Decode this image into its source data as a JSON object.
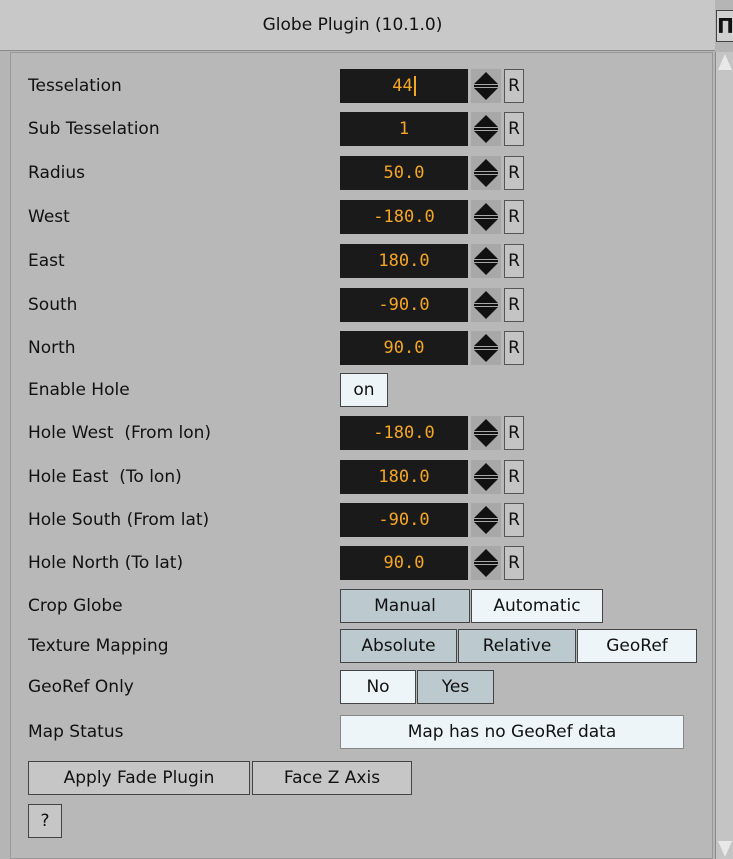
{
  "window": {
    "title": "Globe Plugin (10.1.0)",
    "title_icon": "Π"
  },
  "numeric_fields": [
    {
      "label": "Tesselation",
      "value": "44"
    },
    {
      "label": "Sub Tesselation",
      "value": "1"
    },
    {
      "label": "Radius",
      "value": "50.0"
    },
    {
      "label": "West",
      "value": "-180.0"
    },
    {
      "label": "East",
      "value": "180.0"
    },
    {
      "label": "South",
      "value": "-90.0"
    },
    {
      "label": "North",
      "value": "90.0"
    }
  ],
  "reset_label": "R",
  "enable_hole": {
    "label": "Enable Hole",
    "value": "on"
  },
  "hole_fields": [
    {
      "label": "Hole West  (From lon)",
      "value": "-180.0"
    },
    {
      "label": "Hole East  (To lon)",
      "value": "180.0"
    },
    {
      "label": "Hole South (From lat)",
      "value": "-90.0"
    },
    {
      "label": "Hole North (To lat)",
      "value": "90.0"
    }
  ],
  "crop_globe": {
    "label": "Crop Globe",
    "options": [
      "Manual",
      "Automatic"
    ],
    "selected": "Automatic"
  },
  "texture_mapping": {
    "label": "Texture Mapping",
    "options": [
      "Absolute",
      "Relative",
      "GeoRef"
    ],
    "selected": "GeoRef"
  },
  "georef_only": {
    "label": "GeoRef Only",
    "options": [
      "No",
      "Yes"
    ],
    "selected": "No"
  },
  "map_status": {
    "label": "Map Status",
    "value": "Map has no GeoRef data"
  },
  "buttons": {
    "apply_fade": "Apply Fade Plugin",
    "face_z": "Face Z Axis",
    "help": "?"
  },
  "colors": {
    "field_bg": "#1a1a1a",
    "field_text": "#f5a623",
    "toggle_off": "#bcc9cf",
    "toggle_on": "#eef5f8"
  }
}
